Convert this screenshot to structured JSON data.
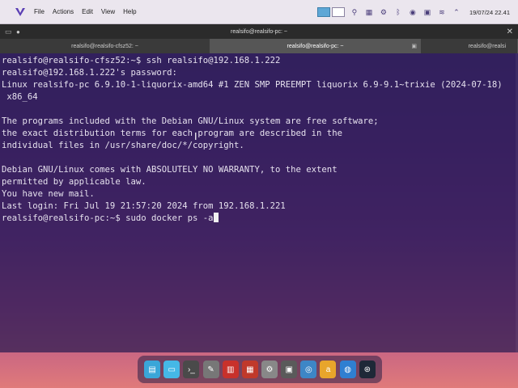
{
  "panel": {
    "menu": [
      "File",
      "Actions",
      "Edit",
      "View",
      "Help"
    ],
    "clock": "19/07/24 22.41"
  },
  "window": {
    "title": "realsifo@realsifo-pc: ~"
  },
  "tabs": [
    {
      "label": "realsifo@realsifo-cfsz52: ~",
      "active": false
    },
    {
      "label": "realsifo@realsifo-pc: ~",
      "active": true
    },
    {
      "label": "realsifo@realsi",
      "active": false
    }
  ],
  "terminal": {
    "lines": [
      "realsifo@realsifo-cfsz52:~$ ssh realsifo@192.168.1.222",
      "realsifo@192.168.1.222's password:",
      "Linux realsifo-pc 6.9.10-1-liquorix-amd64 #1 ZEN SMP PREEMPT liquorix 6.9-9.1~trixie (2024-07-18)",
      " x86_64",
      "",
      "The programs included with the Debian GNU/Linux system are free software;",
      "the exact distribution terms for each program are described in the",
      "individual files in /usr/share/doc/*/copyright.",
      "",
      "Debian GNU/Linux comes with ABSOLUTELY NO WARRANTY, to the extent",
      "permitted by applicable law.",
      "You have new mail.",
      "Last login: Fri Jul 19 21:57:20 2024 from 192.168.1.221"
    ],
    "prompt_line": "realsifo@realsifo-pc:~$ sudo docker ps -a"
  },
  "dock": {
    "icons": [
      "files-icon",
      "folder-icon",
      "terminal-icon",
      "text-editor-icon",
      "pdf-icon",
      "system-monitor-icon",
      "settings-icon",
      "screenshot-icon",
      "network-icon",
      "appstore-icon",
      "browser-icon",
      "steam-icon"
    ]
  },
  "colors": {
    "prompt": "#e6e1ee",
    "terminal_bg": "#2a1a50",
    "panel_bg": "#ebe6ee"
  }
}
